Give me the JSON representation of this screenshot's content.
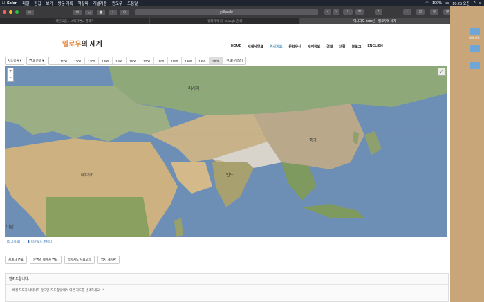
{
  "menubar": {
    "apple": "",
    "items": [
      "Safari",
      "파일",
      "편집",
      "보기",
      "방문 기록",
      "책갈피",
      "개발자용",
      "윈도우",
      "도움말"
    ],
    "battery": "100%",
    "time": "10:25 오전"
  },
  "browser": {
    "address": "yellow.kr",
    "tabs": [
      "패턴요즘 ▸ 너야하면 ▸ 결과기",
      "유레카/유리 - Google 검색",
      "역사지도 2000년 - 옐로우의 세계"
    ]
  },
  "site": {
    "logo_main": "옐로우",
    "logo_rest": "의 세계",
    "nav": [
      "HOME",
      "세계사연표",
      "역사지도",
      "문화유산",
      "세계정보",
      "경제",
      "생활",
      "블로그",
      "ENGLISH"
    ]
  },
  "controls": {
    "map_type": "지도종류",
    "year_select": "연대 선택",
    "years": [
      "1100",
      "1200",
      "1300",
      "1400",
      "1500",
      "1600",
      "1700",
      "1800",
      "1850",
      "1900",
      "1950",
      "2000"
    ],
    "selected_year": "2000",
    "current": "현재(구글맵)"
  },
  "map": {
    "labels": [
      "러시아",
      "중국",
      "인도",
      "마달",
      "아프리카"
    ],
    "zoom_in": "+",
    "zoom_out": "−"
  },
  "links": [
    "[참고자료]",
    "다운로드 [PNG]"
  ],
  "buttons": [
    "세계사 연표",
    "문명별 세계사 연표",
    "역사지도 자료모음",
    "역사 게시판"
  ],
  "notice": {
    "title": "알려드립니다.",
    "line": "- 배경 지도가 나타나지 않으면 '지도종류'에서 다른 지도를 선택하세요. ^^"
  },
  "desktop": {
    "items": [
      "세계 지도",
      "",
      ""
    ]
  }
}
